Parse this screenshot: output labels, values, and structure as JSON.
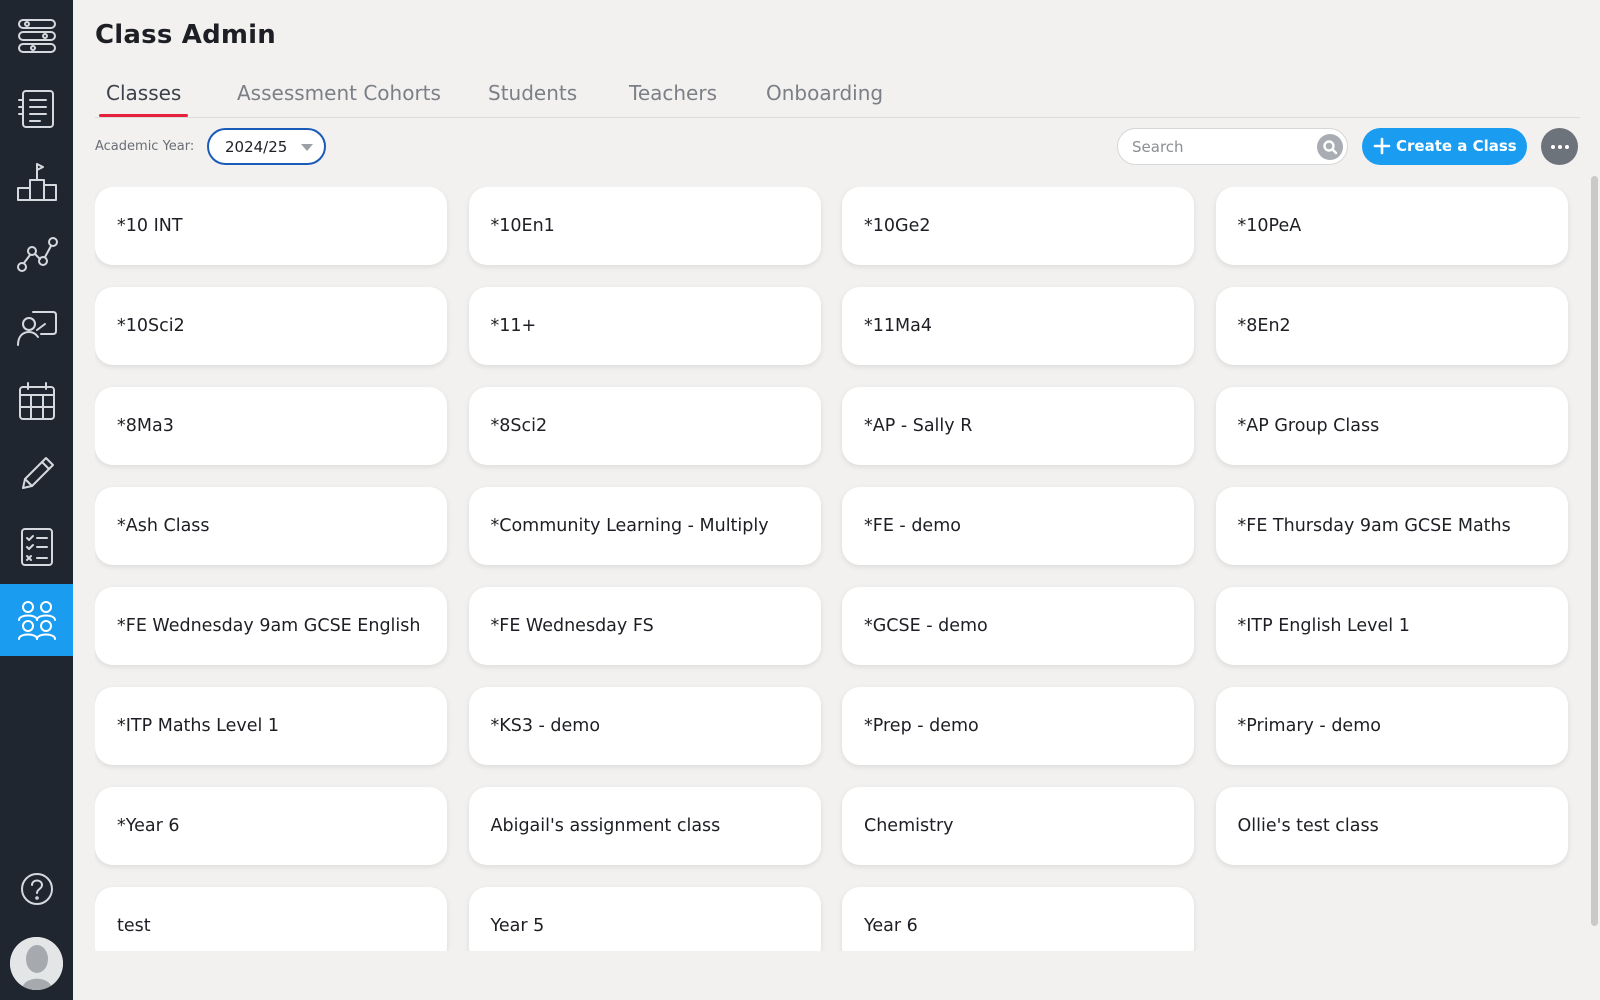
{
  "page": {
    "title": "Class Admin"
  },
  "tabs": [
    {
      "label": "Classes",
      "active": true
    },
    {
      "label": "Assessment Cohorts",
      "active": false
    },
    {
      "label": "Students",
      "active": false
    },
    {
      "label": "Teachers",
      "active": false
    },
    {
      "label": "Onboarding",
      "active": false
    }
  ],
  "toolbar": {
    "academic_year_label": "Academic Year:",
    "academic_year_value": "2024/25",
    "search_placeholder": "Search",
    "create_button_label": "Create a Class"
  },
  "sidebar": {
    "items": [
      {
        "icon": "workflow-icon",
        "active": false
      },
      {
        "icon": "list-icon",
        "active": false
      },
      {
        "icon": "podium-icon",
        "active": false
      },
      {
        "icon": "analytics-icon",
        "active": false
      },
      {
        "icon": "teacher-board-icon",
        "active": false
      },
      {
        "icon": "calendar-icon",
        "active": false
      },
      {
        "icon": "pencil-icon",
        "active": false
      },
      {
        "icon": "checklist-icon",
        "active": false
      },
      {
        "icon": "users-icon",
        "active": true
      },
      {
        "icon": "help-icon",
        "active": false
      }
    ]
  },
  "colors": {
    "accent": "#1a9cf0",
    "sidebar": "#1f2630",
    "tab_underline": "#e5203c",
    "background": "#f2f1ef"
  },
  "classes": [
    "*10 INT",
    "*10En1",
    "*10Ge2",
    "*10PeA",
    "*10Sci2",
    "*11+",
    "*11Ma4",
    "*8En2",
    "*8Ma3",
    "*8Sci2",
    "*AP - Sally R",
    "*AP Group Class",
    "*Ash Class",
    "*Community Learning - Multiply",
    "*FE - demo",
    "*FE Thursday 9am GCSE Maths",
    "*FE Wednesday 9am GCSE English",
    "*FE Wednesday FS",
    "*GCSE - demo",
    "*ITP English Level 1",
    "*ITP Maths Level 1",
    "*KS3 - demo",
    "*Prep - demo",
    "*Primary - demo",
    "*Year 6",
    "Abigail's assignment class",
    "Chemistry",
    "Ollie's test class",
    "test",
    "Year 5",
    "Year 6"
  ]
}
